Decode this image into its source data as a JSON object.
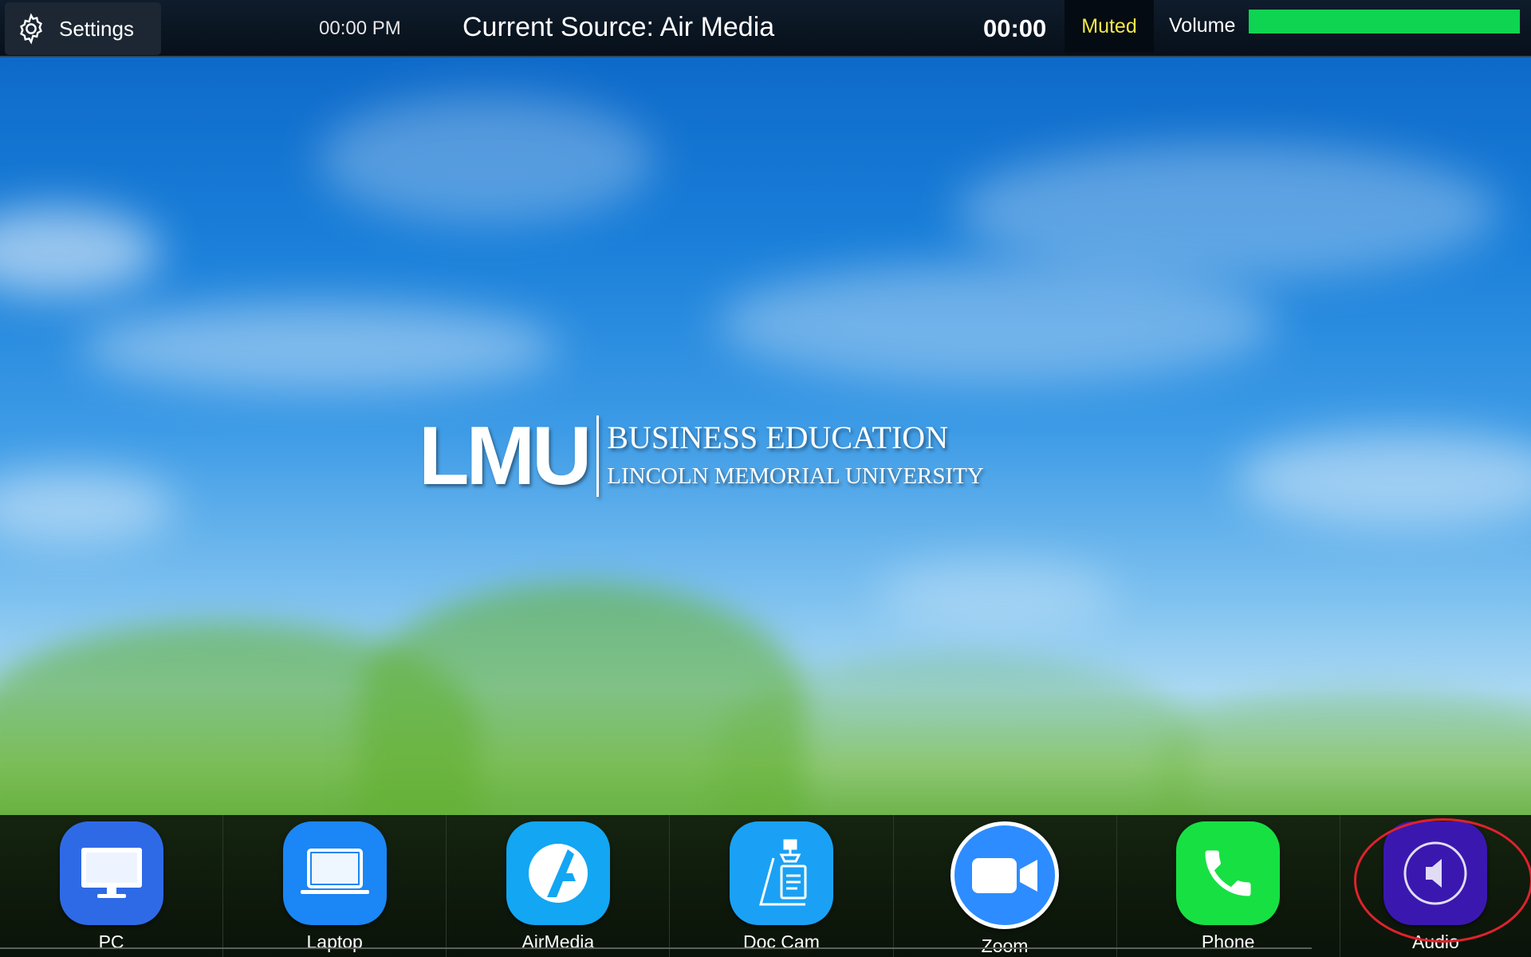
{
  "topbar": {
    "settings_label": "Settings",
    "clock": "00:00 PM",
    "current_source": "Current Source: Air Media",
    "timer": "00:00",
    "muted_label": "Muted",
    "volume_label": "Volume",
    "volume_level": 1.0,
    "volume_color": "#0ed451",
    "muted_color": "#f2e84a"
  },
  "logo": {
    "mark": "LMU",
    "line1": "BUSINESS EDUCATION",
    "line2": "LINCOLN MEMORIAL UNIVERSITY"
  },
  "dock": {
    "items": [
      {
        "label": "PC",
        "icon": "monitor-icon",
        "color": "#2f6ae6"
      },
      {
        "label": "Laptop",
        "icon": "laptop-icon",
        "color": "#1b86f5"
      },
      {
        "label": "AirMedia",
        "icon": "airmedia-icon",
        "color": "#12a6f3"
      },
      {
        "label": "Doc Cam",
        "icon": "document-camera-icon",
        "color": "#1aa1f5"
      },
      {
        "label": "Zoom",
        "icon": "video-camera-icon",
        "color": "#2d8cff"
      },
      {
        "label": "Phone",
        "icon": "phone-icon",
        "color": "#17e043"
      },
      {
        "label": "Audio",
        "icon": "speaker-icon",
        "color": "#3a18b0"
      }
    ]
  }
}
